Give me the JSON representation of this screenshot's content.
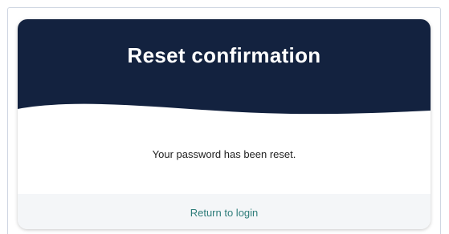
{
  "card": {
    "title": "Reset confirmation",
    "message": "Your password has been reset.",
    "return_link_label": "Return to login"
  },
  "colors": {
    "header_bg": "#13223f",
    "link": "#2f7d7a",
    "footer_bg": "#f4f6f8"
  }
}
